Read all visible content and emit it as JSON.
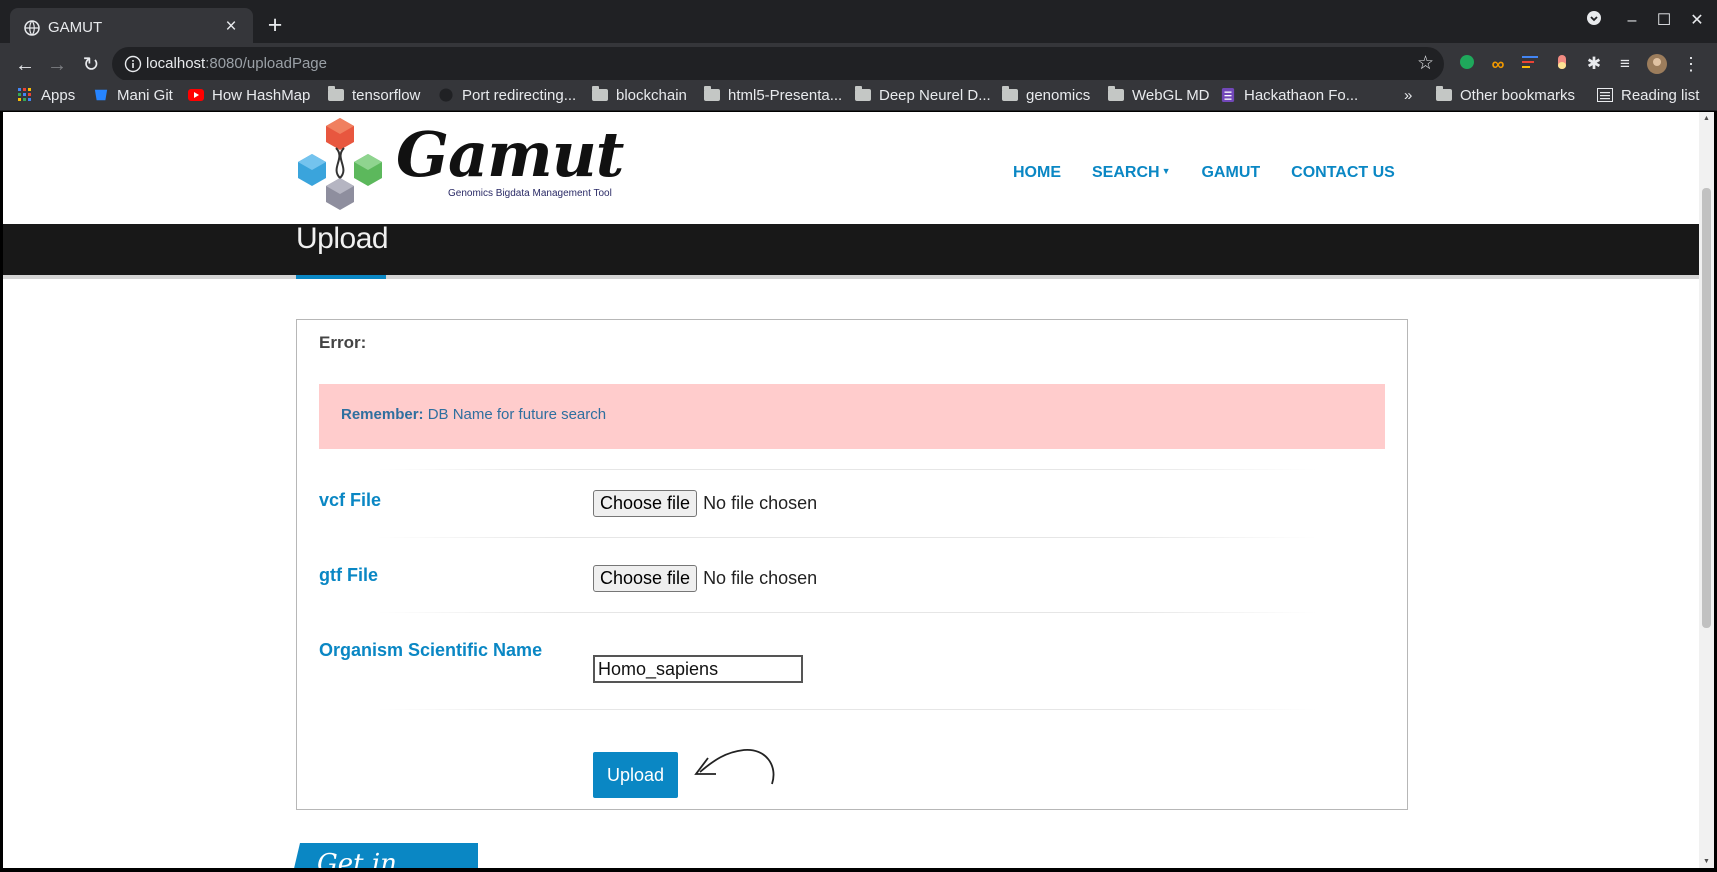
{
  "browser": {
    "tab_title": "GAMUT",
    "url_host": "localhost",
    "url_path": ":8080/uploadPage",
    "bookmarks": [
      {
        "label": "Apps",
        "icon": "apps-icon"
      },
      {
        "label": "Mani Git",
        "icon": "bitbucket-icon"
      },
      {
        "label": "How HashMap",
        "icon": "youtube-icon"
      },
      {
        "label": "tensorflow",
        "icon": "folder-icon"
      },
      {
        "label": "Port redirecting...",
        "icon": "github-icon"
      },
      {
        "label": "blockchain",
        "icon": "folder-icon"
      },
      {
        "label": "html5-Presenta...",
        "icon": "folder-icon"
      },
      {
        "label": "Deep Neurel D...",
        "icon": "folder-icon"
      },
      {
        "label": "genomics",
        "icon": "folder-icon"
      },
      {
        "label": "WebGL MD",
        "icon": "folder-icon"
      },
      {
        "label": "Hackathaon Fo...",
        "icon": "forms-icon"
      }
    ],
    "more_bookmarks": "»",
    "other_bookmarks": "Other bookmarks",
    "reading_list": "Reading list"
  },
  "site": {
    "logo_text": "Gamut",
    "logo_tagline": "Genomics Bigdata Management Tool",
    "nav": [
      "HOME",
      "SEARCH",
      "GAMUT",
      "CONTACT US"
    ],
    "page_title": "Upload"
  },
  "form": {
    "error_label": "Error:",
    "alert_bold": "Remember:",
    "alert_text": "DB Name for future search",
    "vcf_label": "vcf File",
    "gtf_label": "gtf File",
    "choose_file": "Choose file",
    "no_file": "No file chosen",
    "organism_label": "Organism Scientific Name",
    "organism_value": "Homo_sapiens",
    "upload_label": "Upload"
  },
  "footer": {
    "get_in_touch": "Get in Touch"
  },
  "colors": {
    "accent": "#0a87c4",
    "alert_bg": "#ffcccc",
    "title_bar": "#181818"
  }
}
